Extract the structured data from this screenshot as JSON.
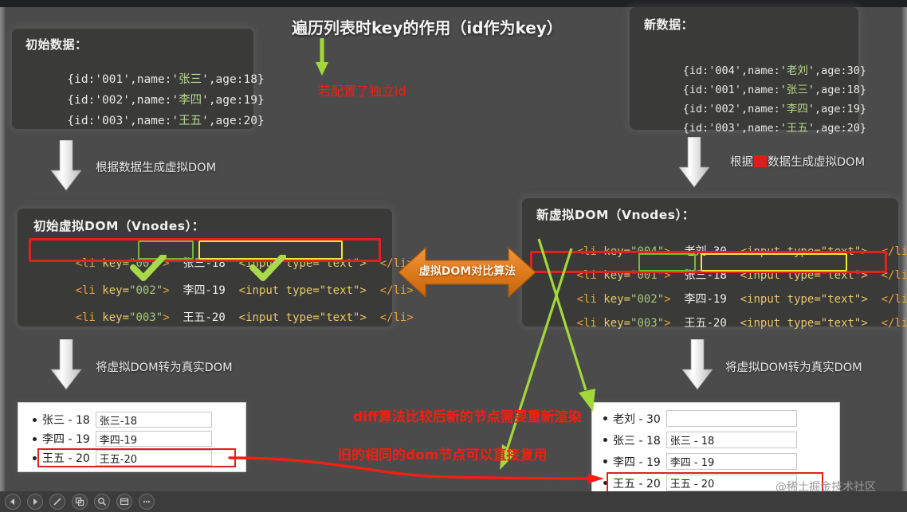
{
  "title": "遍历列表时key的作用（id作为key）",
  "annotations": {
    "independent_id": "若配置了独立id",
    "diff_rerender": "diff算法比较后新的节点需要重新渲染",
    "reuse_dom": "旧的相同的dom节点可以直接复用",
    "compare_arrow": "虚拟DOM对比算法"
  },
  "steps": {
    "gen_vdom_left": "根据数据生成虚拟DOM",
    "gen_vdom_right_prefix": "根据",
    "gen_vdom_right_suffix": "数据生成虚拟DOM",
    "to_real_dom_left": "将虚拟DOM转为真实DOM",
    "to_real_dom_right": "将虚拟DOM转为真实DOM"
  },
  "initial_data": {
    "heading": "初始数据：",
    "rows": [
      {
        "id": "001",
        "name": "张三",
        "age": "18"
      },
      {
        "id": "002",
        "name": "李四",
        "age": "19"
      },
      {
        "id": "003",
        "name": "王五",
        "age": "20"
      }
    ]
  },
  "new_data": {
    "heading": "新数据：",
    "rows": [
      {
        "id": "004",
        "name": "老刘",
        "age": "30"
      },
      {
        "id": "001",
        "name": "张三",
        "age": "18"
      },
      {
        "id": "002",
        "name": "李四",
        "age": "19"
      },
      {
        "id": "003",
        "name": "王五",
        "age": "20"
      }
    ]
  },
  "vdom_old": {
    "heading": "初始虚拟DOM（Vnodes）：",
    "rows": [
      {
        "key": "001",
        "text": "张三-18",
        "input": "<input type=\"text\">",
        "highlight": "red"
      },
      {
        "key": "002",
        "text": "李四-19",
        "input": "<input type=\"text\">",
        "highlight": "none"
      },
      {
        "key": "003",
        "text": "王五-20",
        "input": "<input type=\"text\">",
        "highlight": "none"
      }
    ]
  },
  "vdom_new": {
    "heading": "新虚拟DOM（Vnodes）：",
    "rows": [
      {
        "key": "004",
        "text": "老刘-30",
        "input": "<input type=\"text\">",
        "highlight": "none"
      },
      {
        "key": "001",
        "text": "张三-18",
        "input": "<input type=\"text\">",
        "highlight": "red"
      },
      {
        "key": "002",
        "text": "李四-19",
        "input": "<input type=\"text\">",
        "highlight": "none"
      },
      {
        "key": "003",
        "text": "王五-20",
        "input": "<input type=\"text\">",
        "highlight": "none"
      }
    ]
  },
  "real_old": {
    "rows": [
      {
        "label": "张三 - 18",
        "input_value": "张三-18",
        "highlight": false
      },
      {
        "label": "李四 - 19",
        "input_value": "李四-19",
        "highlight": false
      },
      {
        "label": "王五 - 20",
        "input_value": "王五-20",
        "highlight": true
      }
    ]
  },
  "real_new": {
    "rows": [
      {
        "label": "老刘 - 30",
        "input_value": "",
        "highlight": false
      },
      {
        "label": "张三 - 18",
        "input_value": "张三 - 18",
        "highlight": false
      },
      {
        "label": "李四 - 19",
        "input_value": "李四 - 19",
        "highlight": false
      },
      {
        "label": "王五 - 20",
        "input_value": "王五 - 20",
        "highlight": true
      }
    ]
  },
  "watermark": "@稀土掘金技术社区",
  "toolbar": {
    "buttons": [
      {
        "name": "prev-button",
        "icon": "triangle-left-icon"
      },
      {
        "name": "next-button",
        "icon": "triangle-right-icon"
      },
      {
        "name": "pen-button",
        "icon": "pen-icon"
      },
      {
        "name": "copy-button",
        "icon": "copy-icon"
      },
      {
        "name": "zoom-button",
        "icon": "magnifier-icon"
      },
      {
        "name": "window-button",
        "icon": "window-icon"
      },
      {
        "name": "more-button",
        "icon": "ellipsis-icon"
      }
    ]
  },
  "colors": {
    "accent_red": "#e2201c",
    "accent_green": "#77b43f",
    "accent_yellow": "#f2e63c",
    "accent_orange": "#e07b22",
    "annotation_red": "#f51d12",
    "arrow_green": "#a3d83a",
    "background": "#4b4b4b",
    "panel": "#3a3a38"
  }
}
